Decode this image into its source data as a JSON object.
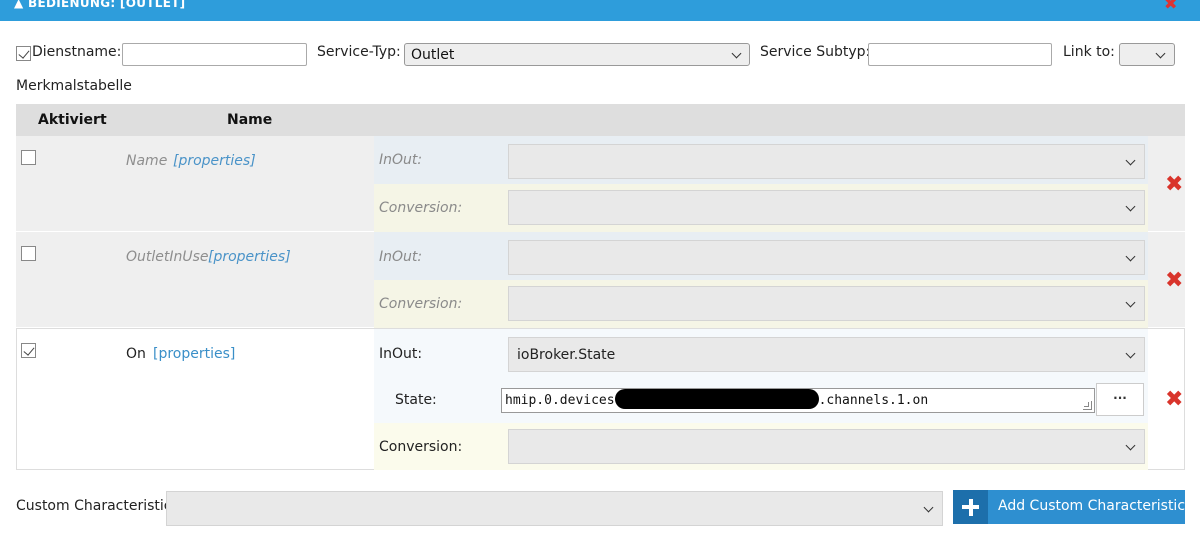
{
  "header": {
    "title": "▲ BEDIENUNG: [OUTLET]",
    "close": "✖"
  },
  "top": {
    "dienstname_label": "Dienstname:",
    "dienstname_value": "",
    "servicetyp_label": "Service-Typ:",
    "servicetyp_value": "Outlet",
    "subtyp_label": "Service Subtyp:",
    "subtyp_value": "",
    "linkto_label": "Link to:",
    "linkto_value": ""
  },
  "table": {
    "caption": "Merkmalstabelle",
    "headers": {
      "aktiviert": "Aktiviert",
      "name": "Name"
    },
    "rows": [
      {
        "name": "Name",
        "properties": "[properties]",
        "inout_label": "InOut:",
        "inout_value": "",
        "conversion_label": "Conversion:",
        "conversion_value": "",
        "checked": false
      },
      {
        "name": "OutletInUse",
        "properties": "[properties]",
        "inout_label": "InOut:",
        "inout_value": "",
        "conversion_label": "Conversion:",
        "conversion_value": "",
        "checked": false
      },
      {
        "name": "On",
        "properties": "[properties]",
        "inout_label": "InOut:",
        "inout_value": "ioBroker.State",
        "state_label": "State:",
        "state_prefix": "hmip.0.devices",
        "state_suffix": ".channels.1.on",
        "dots": "···",
        "conversion_label": "Conversion:",
        "conversion_value": "",
        "checked": true
      }
    ]
  },
  "footer": {
    "custom_label": "Custom Characteristic",
    "custom_value": "",
    "add_button": "Add Custom Characteristic"
  },
  "colors": {
    "accent": "#2e9ddb",
    "delete": "#d9342b",
    "link": "#3a8fc8"
  }
}
